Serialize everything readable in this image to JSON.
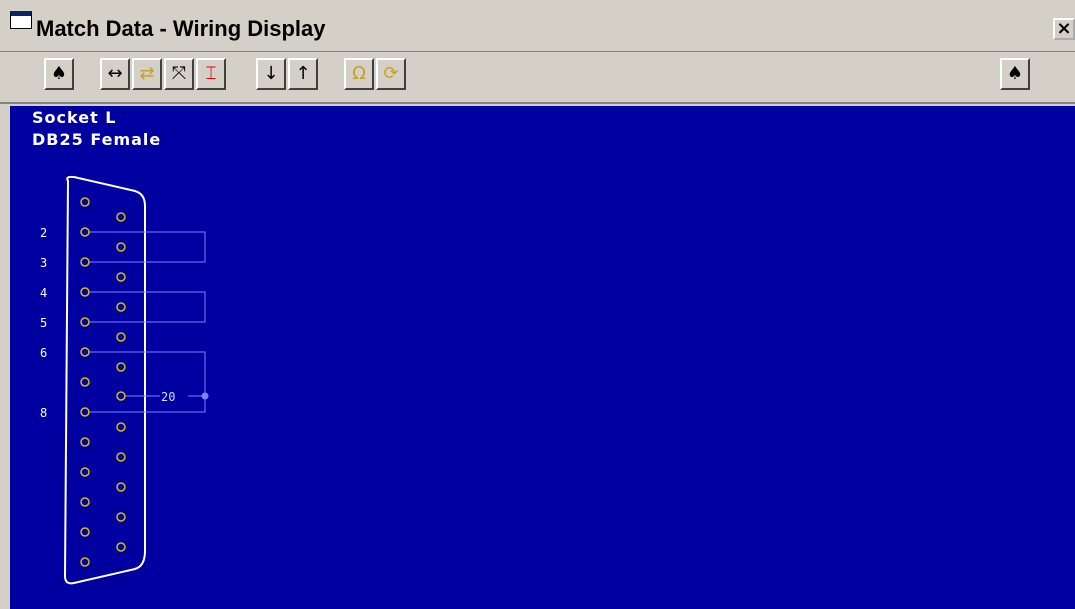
{
  "window": {
    "title": "Match Data - Wiring Display",
    "close_icon": "close-icon"
  },
  "toolbar": {
    "buttons": [
      {
        "name": "connector-left-button",
        "glyph": "♠",
        "enabled": true
      },
      {
        "name": "stretch-horizontal-button",
        "glyph": "↔",
        "enabled": true
      },
      {
        "name": "swap-button",
        "glyph": "⇄",
        "enabled": false
      },
      {
        "name": "expand-button",
        "glyph": "⤧",
        "enabled": true
      },
      {
        "name": "wire-highlight-button",
        "glyph": "⌶",
        "enabled": true
      },
      {
        "name": "arrow-down-button",
        "glyph": "↓",
        "enabled": true
      },
      {
        "name": "arrow-up-button",
        "glyph": "↑",
        "enabled": true
      },
      {
        "name": "ohm-button",
        "glyph": "Ω",
        "enabled": false
      },
      {
        "name": "rotate-button",
        "glyph": "⟳",
        "enabled": false
      },
      {
        "name": "connector-right-button",
        "glyph": "♠",
        "enabled": true
      }
    ]
  },
  "connector": {
    "line1": "Socket L",
    "line2": "DB25 Female",
    "pin_labels": [
      "2",
      "3",
      "4",
      "5",
      "6",
      "8"
    ],
    "jumper_label": "20",
    "colors": {
      "background": "#0000a0",
      "pin": "#d4c000",
      "wire": "#8080ff",
      "outline": "#ffffff"
    }
  }
}
